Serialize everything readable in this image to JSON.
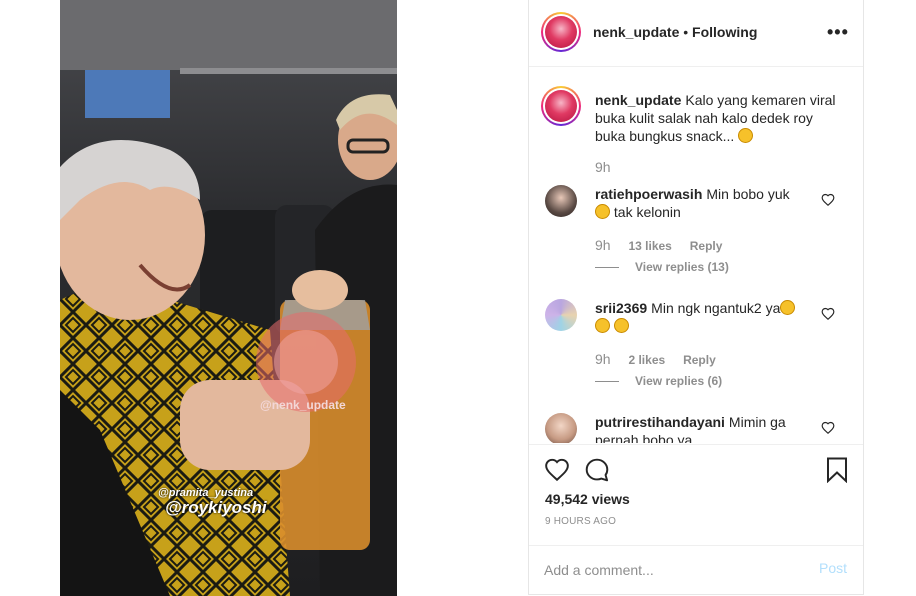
{
  "post": {
    "username": "nenk_update",
    "follow_status": "Following",
    "more_icon": "more-horizontal-icon",
    "caption": {
      "username": "nenk_update",
      "text": "Kalo yang kemaren viral buka kulit salak nah kalo dedek roy buka bungkus snack...",
      "emoji": "grinning-face",
      "time": "9h"
    },
    "comments": [
      {
        "username": "ratiehpoerwasih",
        "text": "Min bobo yuk",
        "text2": "tak kelonin",
        "time": "9h",
        "likes": "13 likes",
        "reply": "Reply",
        "view_replies": "View replies (13)"
      },
      {
        "username": "srii2369",
        "text": "Min ngk ngantuk2 ya",
        "time": "9h",
        "likes": "2 likes",
        "reply": "Reply",
        "view_replies": "View replies (6)"
      },
      {
        "username": "putrirestihandayani",
        "text": "Mimin ga pernah bobo ya"
      }
    ],
    "views": "49,542 views",
    "time_ago": "9 HOURS AGO",
    "add_comment_placeholder": "Add a comment...",
    "post_label": "Post",
    "video_overlay": {
      "watermark": "@nenk_update",
      "credit_small": "@pramita_yustina",
      "credit_large": "@roykiyoshi"
    }
  },
  "colors": {
    "link_disabled": "#b2dffc",
    "secondary_text": "#8e8e8e",
    "primary_text": "#262626"
  }
}
